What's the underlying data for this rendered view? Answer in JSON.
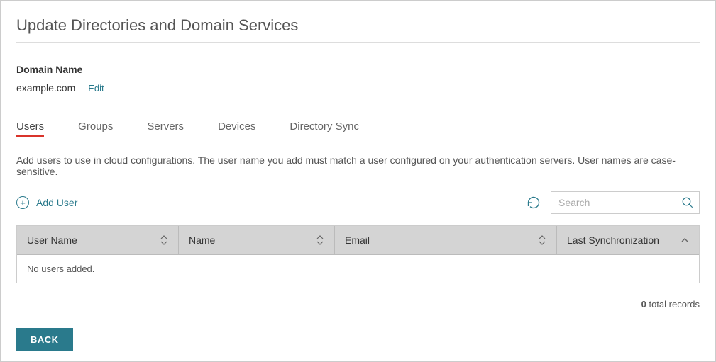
{
  "page": {
    "title": "Update Directories and Domain Services"
  },
  "domain": {
    "label": "Domain Name",
    "value": "example.com",
    "edit_label": "Edit"
  },
  "tabs": {
    "users": "Users",
    "groups": "Groups",
    "servers": "Servers",
    "devices": "Devices",
    "sync": "Directory Sync"
  },
  "users_tab": {
    "description": "Add users to use in cloud configurations. The user name you add must match a user configured on your authentication servers. User names are case-sensitive.",
    "add_user_label": "Add User",
    "search_placeholder": "Search",
    "columns": {
      "user_name": "User Name",
      "name": "Name",
      "email": "Email",
      "last_sync": "Last Synchronization"
    },
    "empty_message": "No users added.",
    "records_count": "0",
    "records_suffix": " total records"
  },
  "buttons": {
    "back": "BACK"
  }
}
